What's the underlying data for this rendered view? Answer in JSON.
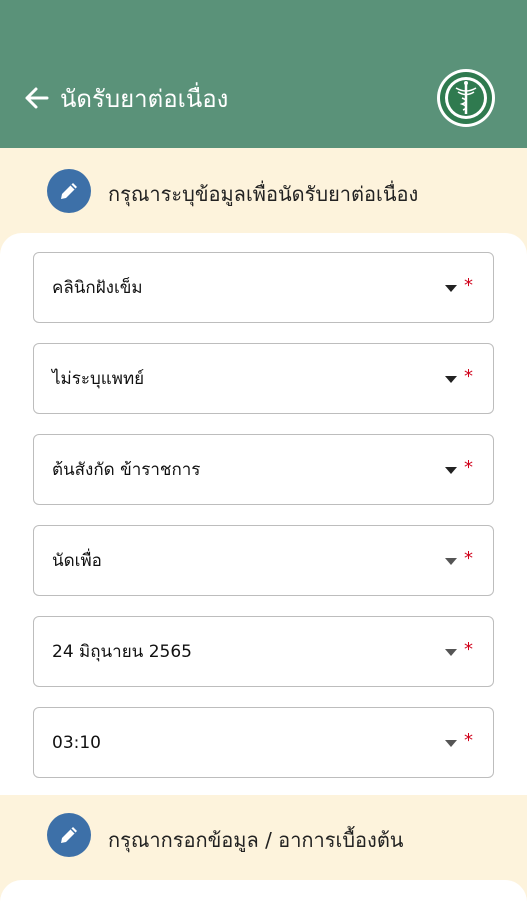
{
  "header": {
    "title": "นัดรับยาต่อเนื่อง",
    "background_color": "#5a9279"
  },
  "section1": {
    "title": "กรุณาระบุข้อมูลเพื่อนัดรับยาต่อเนื่อง",
    "icon": "pencil-icon"
  },
  "fields": [
    {
      "value": "คลินิกฝังเข็ม",
      "required_mark": "*"
    },
    {
      "value": "ไม่ระบุแพทย์",
      "required_mark": "*"
    },
    {
      "value": "ต้นสังกัด ข้าราชการ",
      "required_mark": "*"
    },
    {
      "value": "นัดเพื่อ",
      "required_mark": "*"
    },
    {
      "value": "24 มิถุนายน 2565",
      "required_mark": "*"
    },
    {
      "value": "03:10",
      "required_mark": "*"
    }
  ],
  "section2": {
    "title": "กรุณากรอกข้อมูล / อาการเบื้องต้น",
    "icon": "pencil-icon"
  },
  "colors": {
    "accent_blue": "#3d70a8",
    "required_red": "#d0021b",
    "page_background": "#fdf3dc"
  }
}
